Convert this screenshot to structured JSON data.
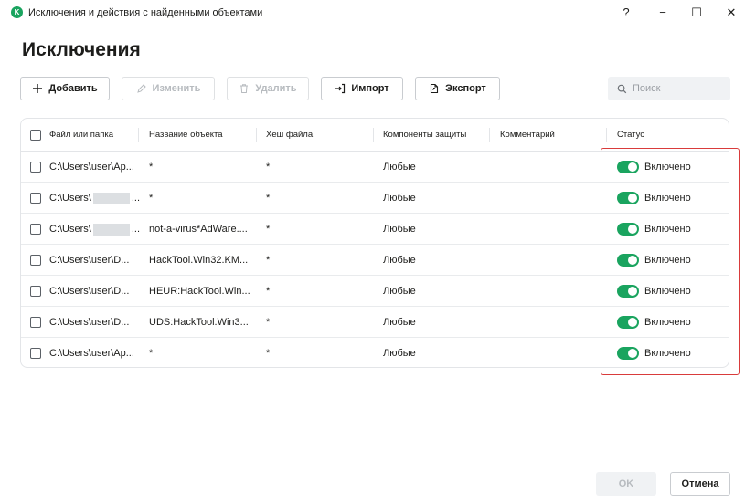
{
  "window": {
    "logo_letter": "K",
    "title": "Исключения и действия с найденными объектами",
    "help": "?",
    "minimize": "−",
    "maximize": "☐",
    "close": "✕"
  },
  "page": {
    "title": "Исключения"
  },
  "toolbar": {
    "add_label": "Добавить",
    "edit_label": "Изменить",
    "delete_label": "Удалить",
    "import_label": "Импорт",
    "export_label": "Экспорт",
    "search_placeholder": "Поиск"
  },
  "table": {
    "columns": [
      "Файл или папка",
      "Название объекта",
      "Хеш файла",
      "Компоненты защиты",
      "Комментарий",
      "Статус"
    ],
    "rows": [
      {
        "file": "C:\\Users\\user\\Ap...",
        "file_redacted": false,
        "file_suffix": "",
        "object": "*",
        "hash": "*",
        "components": "Любые",
        "comment": "",
        "status": "Включено"
      },
      {
        "file": "C:\\Users\\",
        "file_redacted": true,
        "file_suffix": "...",
        "object": "*",
        "hash": "*",
        "components": "Любые",
        "comment": "",
        "status": "Включено"
      },
      {
        "file": "C:\\Users\\",
        "file_redacted": true,
        "file_suffix": "...",
        "object": "not-a-virus*AdWare....",
        "hash": "*",
        "components": "Любые",
        "comment": "",
        "status": "Включено"
      },
      {
        "file": "C:\\Users\\user\\D...",
        "file_redacted": false,
        "file_suffix": "",
        "object": "HackTool.Win32.KM...",
        "hash": "*",
        "components": "Любые",
        "comment": "",
        "status": "Включено"
      },
      {
        "file": "C:\\Users\\user\\D...",
        "file_redacted": false,
        "file_suffix": "",
        "object": "HEUR:HackTool.Win...",
        "hash": "*",
        "components": "Любые",
        "comment": "",
        "status": "Включено"
      },
      {
        "file": "C:\\Users\\user\\D...",
        "file_redacted": false,
        "file_suffix": "",
        "object": "UDS:HackTool.Win3...",
        "hash": "*",
        "components": "Любые",
        "comment": "",
        "status": "Включено"
      },
      {
        "file": "C:\\Users\\user\\Ap...",
        "file_redacted": false,
        "file_suffix": "",
        "object": "*",
        "hash": "*",
        "components": "Любые",
        "comment": "",
        "status": "Включено"
      }
    ]
  },
  "footer": {
    "ok_label": "OK",
    "cancel_label": "Отмена"
  },
  "colors": {
    "accent": "#1aa45f",
    "highlight": "#d93b3b",
    "disabled_text": "#b7bbbf"
  }
}
